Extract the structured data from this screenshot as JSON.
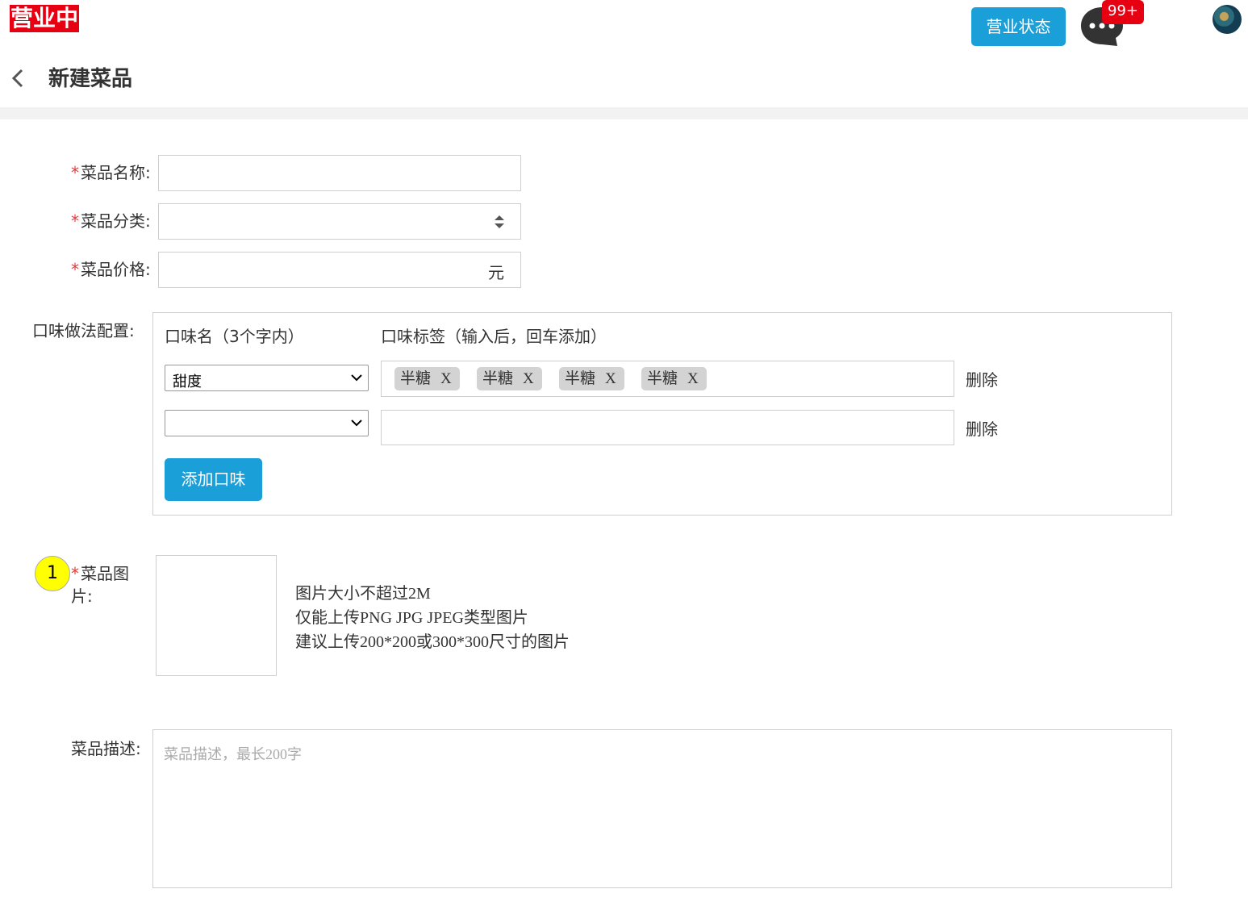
{
  "header": {
    "store_status": "营业中",
    "status_button": "营业状态",
    "message_badge": "99+",
    "page_title": "新建菜品"
  },
  "form": {
    "required_mark": "*",
    "name_label": "菜品名称:",
    "name_value": "",
    "category_label": "菜品分类:",
    "category_value": "",
    "price_label": "菜品价格:",
    "price_value": "",
    "price_unit": "元",
    "flavor_label": "口味做法配置:",
    "flavor_name_header": "口味名（3个字内）",
    "flavor_tags_header": "口味标签（输入后，回车添加）",
    "flavor_rows": [
      {
        "name": "甜度",
        "tags": [
          "半糖",
          "半糖",
          "半糖",
          "半糖"
        ],
        "tag_remove": "X",
        "delete_label": "删除"
      },
      {
        "name": "",
        "tags": [],
        "delete_label": "删除"
      }
    ],
    "add_flavor_button": "添加口味",
    "step_marker": "1",
    "image_label_line1": "菜品图",
    "image_label_line2": "片:",
    "image_hints": [
      "图片大小不超过2M",
      "仅能上传PNG JPG JPEG类型图片",
      "建议上传200*200或300*300尺寸的图片"
    ],
    "description_label": "菜品描述:",
    "description_placeholder": "菜品描述，最长200字"
  },
  "colors": {
    "accent": "#1a9fd9",
    "status_red": "#e60012"
  }
}
